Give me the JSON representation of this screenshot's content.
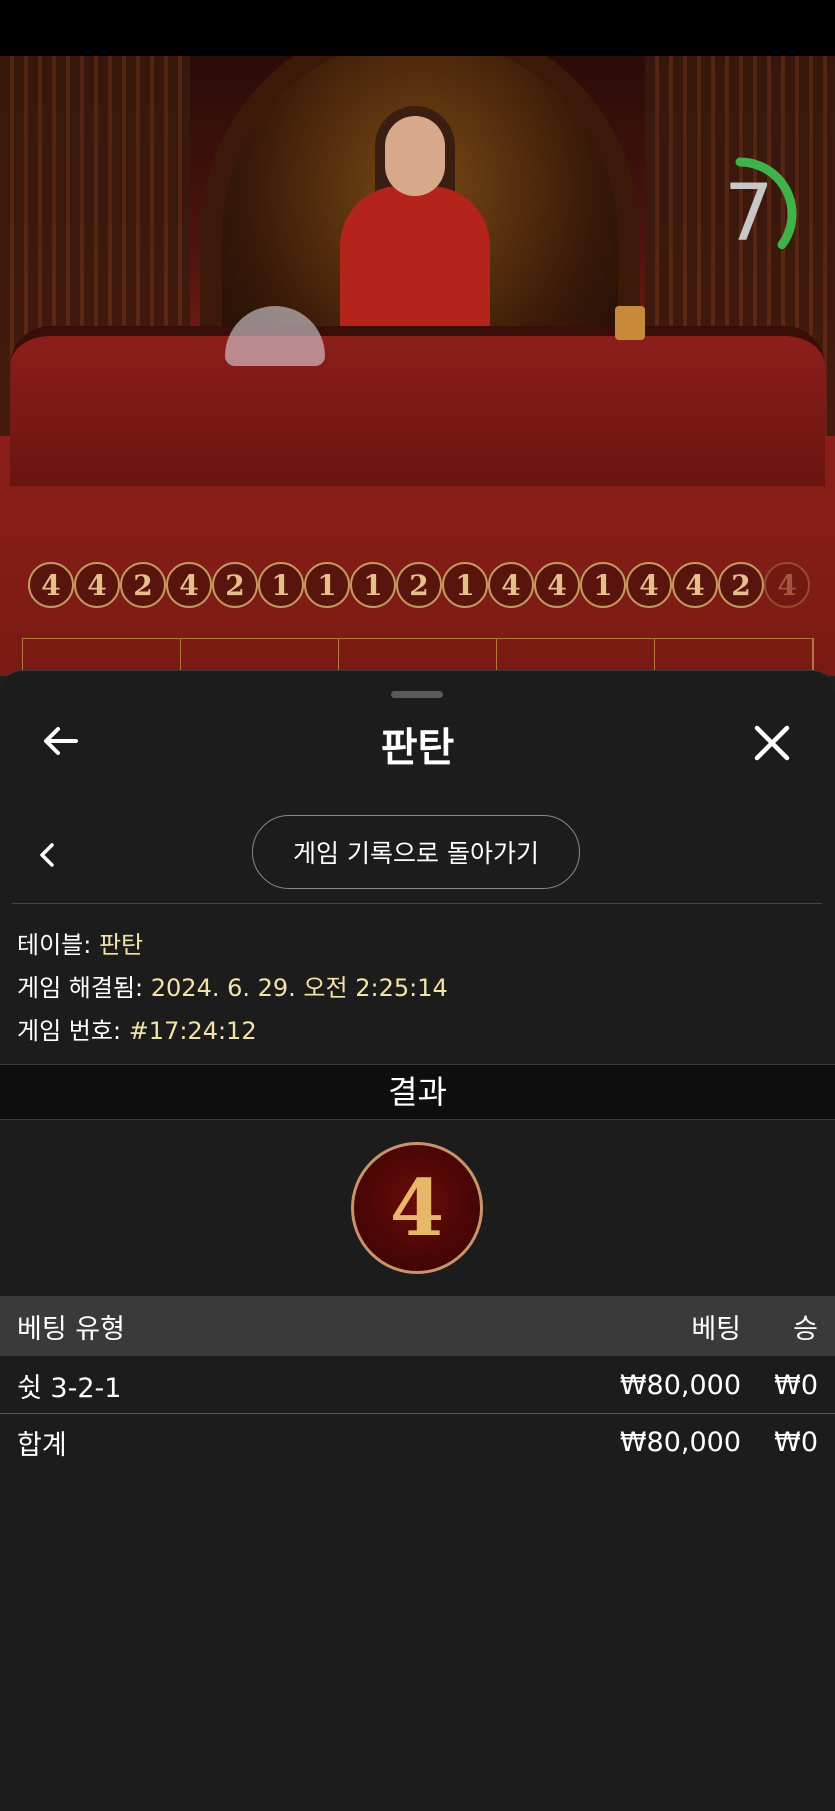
{
  "game_view": {
    "timer_value": "7",
    "timer_progress": 0.35,
    "colors": {
      "timer_ring": "#3fb24a",
      "felt": "#8a1f18"
    },
    "bead_road": [
      "4",
      "4",
      "2",
      "4",
      "2",
      "1",
      "1",
      "1",
      "2",
      "1",
      "4",
      "4",
      "1",
      "4",
      "4",
      "2",
      "4"
    ]
  },
  "panel": {
    "title": "판탄",
    "history_button": "게임 기록으로 돌아가기",
    "info": {
      "table_label": "테이블:",
      "table_value": "판탄",
      "resolved_label": "게임 해결됨:",
      "resolved_value": "2024. 6. 29. 오전 2:25:14",
      "game_no_label": "게임 번호:",
      "game_no_value": "#17:24:12"
    },
    "result_header": "결과",
    "result_value": "4",
    "table": {
      "headers": {
        "type": "베팅 유형",
        "bet": "베팅",
        "win": "승"
      },
      "rows": [
        {
          "type": "쉿 3-2-1",
          "bet": "₩80,000",
          "win": "₩0"
        }
      ],
      "total": {
        "type": "합계",
        "bet": "₩80,000",
        "win": "₩0"
      }
    }
  }
}
